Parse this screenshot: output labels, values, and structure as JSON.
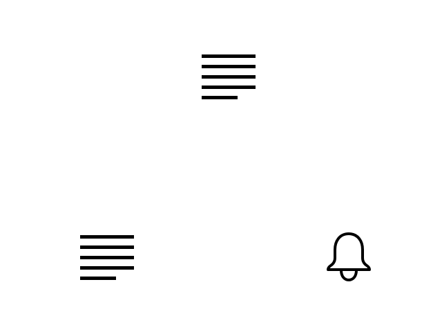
{
  "icons": [
    {
      "name": "text-align-left-icon"
    },
    {
      "name": "text-align-left-icon"
    },
    {
      "name": "bell-icon"
    }
  ],
  "colors": {
    "background": "#ffffff",
    "icon_stroke": "#000000"
  }
}
